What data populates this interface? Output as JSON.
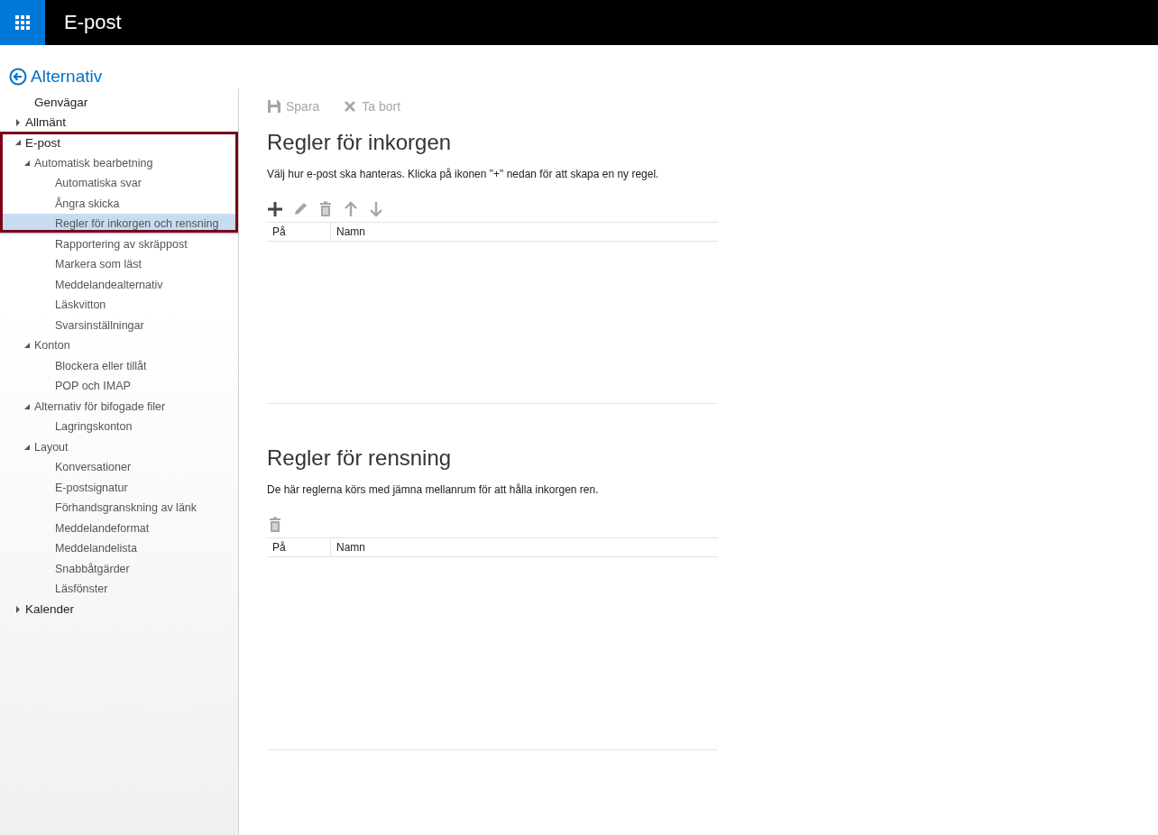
{
  "app_bar": {
    "title": "E-post"
  },
  "back_header": {
    "title": "Alternativ"
  },
  "sidebar": {
    "items": [
      {
        "label": "Genvägar",
        "selected": false
      },
      {
        "label": "Allmänt",
        "expanded": false,
        "selected": false
      },
      {
        "label": "E-post",
        "expanded": true,
        "selected": false,
        "children": [
          {
            "label": "Automatisk bearbetning",
            "expanded": true,
            "selected": false,
            "children": [
              {
                "label": "Automatiska svar",
                "selected": false
              },
              {
                "label": "Ångra skicka",
                "selected": false
              },
              {
                "label": "Regler för inkorgen och rensning",
                "selected": true
              },
              {
                "label": "Rapportering av skräppost",
                "selected": false
              },
              {
                "label": "Markera som läst",
                "selected": false
              },
              {
                "label": "Meddelandealternativ",
                "selected": false
              },
              {
                "label": "Läskvitton",
                "selected": false
              },
              {
                "label": "Svarsinställningar",
                "selected": false
              }
            ]
          },
          {
            "label": "Konton",
            "expanded": true,
            "selected": false,
            "children": [
              {
                "label": "Blockera eller tillåt",
                "selected": false
              },
              {
                "label": "POP och IMAP",
                "selected": false
              }
            ]
          },
          {
            "label": "Alternativ för bifogade filer",
            "expanded": true,
            "selected": false,
            "children": [
              {
                "label": "Lagringskonton",
                "selected": false
              }
            ]
          },
          {
            "label": "Layout",
            "expanded": true,
            "selected": false,
            "children": [
              {
                "label": "Konversationer",
                "selected": false
              },
              {
                "label": "E-postsignatur",
                "selected": false
              },
              {
                "label": "Förhandsgranskning av länk",
                "selected": false
              },
              {
                "label": "Meddelandeformat",
                "selected": false
              },
              {
                "label": "Meddelandelista",
                "selected": false
              },
              {
                "label": "Snabbåtgärder",
                "selected": false
              },
              {
                "label": "Läsfönster",
                "selected": false
              }
            ]
          }
        ]
      },
      {
        "label": "Kalender",
        "expanded": false,
        "selected": false
      }
    ]
  },
  "toolbar": [
    {
      "kind": "save",
      "label": "Spara",
      "disabled": true
    },
    {
      "kind": "delete",
      "label": "Ta bort",
      "disabled": true
    }
  ],
  "sections": [
    {
      "title": "Regler för inkorgen",
      "description": "Välj hur e-post ska hanteras. Klicka på ikonen \"+\" nedan för att skapa en ny regel.",
      "actions": [
        {
          "kind": "add",
          "disabled": false
        },
        {
          "kind": "edit",
          "disabled": true
        },
        {
          "kind": "trash",
          "disabled": true
        },
        {
          "kind": "up",
          "disabled": true
        },
        {
          "kind": "down",
          "disabled": true
        }
      ],
      "table": {
        "columns": [
          "På",
          "Namn"
        ]
      }
    },
    {
      "title": "Regler för rensning",
      "description": "De här reglerna körs med jämna mellanrum för att hålla inkorgen ren.",
      "actions": [
        {
          "kind": "trash",
          "disabled": true
        }
      ],
      "table": {
        "columns": [
          "På",
          "Namn"
        ]
      }
    }
  ]
}
